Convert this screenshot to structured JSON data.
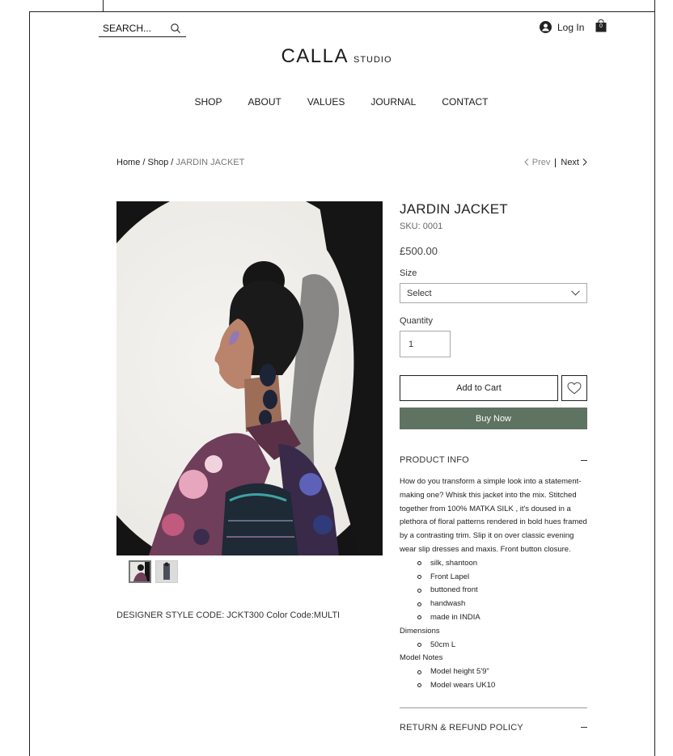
{
  "header": {
    "search_placeholder": "SEARCH...",
    "login_label": "Log In",
    "cart_count": "0",
    "logo_main": "CALLA",
    "logo_sub": "STUDIO"
  },
  "nav": [
    "SHOP",
    "ABOUT",
    "VALUES",
    "JOURNAL",
    "CONTACT"
  ],
  "breadcrumb": {
    "home": "Home",
    "shop": "Shop",
    "current": "JARDIN JACKET",
    "sep": " / ",
    "prev": "Prev",
    "next": "Next"
  },
  "product": {
    "title": "JARDIN JACKET",
    "sku": "SKU: 0001",
    "price": "£500.00",
    "size_label": "Size",
    "size_value": "Select",
    "quantity_label": "Quantity",
    "quantity_value": "1",
    "add_to_cart": "Add to Cart",
    "buy_now": "Buy Now",
    "style_code": "DESIGNER STYLE CODE:  JCKT300 Color Code:MULTI"
  },
  "product_info": {
    "title": "PRODUCT INFO",
    "description": "How do you transform a simple look into a statement-making one? Whisk this jacket into the mix. Stitched together from 100% MATKA SILK , it's doused in a plethora of floral patterns rendered in bold hues framed by a contrasting trim. Slip it on over classic evening wear slip dresses and maxis. Front button closure.",
    "features": [
      "silk, shantoon",
      "Front Lapel",
      "buttoned front",
      "handwash",
      "made in INDIA"
    ],
    "dimensions_label": "Dimensions",
    "dimensions": [
      "50cm L"
    ],
    "model_notes_label": "Model Notes",
    "model_notes": [
      "Model height 5'9\"",
      "Model wears UK10"
    ]
  },
  "return_policy": {
    "title": "RETURN & REFUND POLICY"
  },
  "colors": {
    "buy_now_bg": "#5e7362",
    "text": "#1b1b1b",
    "muted": "#777777"
  }
}
